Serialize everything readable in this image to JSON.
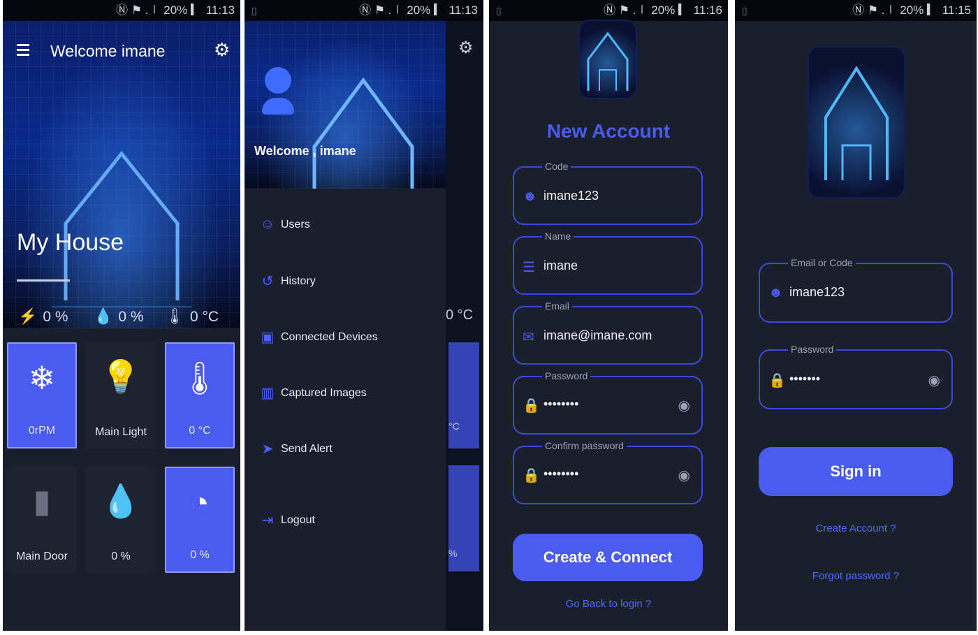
{
  "status": {
    "p1": "Ⓝ ⚑ .∣ 20% ▎ 11:13",
    "p2": "Ⓝ ⚑ .∣ 20% ▎ 11:13",
    "p3": "Ⓝ ⚑ .∣ 20% ▎ 11:16",
    "p4": "Ⓝ ⚑ .∣ 20% ▎ 11:15"
  },
  "home": {
    "welcome": "Welcome imane",
    "house_title": "My House",
    "stats": [
      {
        "icon": "bolt-icon",
        "glyph": "⚡",
        "value": "0 %"
      },
      {
        "icon": "humidity-icon",
        "glyph": "💧",
        "value": "0 %"
      },
      {
        "icon": "thermometer-icon",
        "glyph": "🌡",
        "value": "0 °C"
      }
    ],
    "tiles": [
      {
        "label": "0rPM",
        "icon": "fan-icon",
        "glyph": "❄",
        "on": true
      },
      {
        "label": "Main Light",
        "icon": "bulb-icon",
        "glyph": "💡",
        "on": false
      },
      {
        "label": "0 °C",
        "icon": "thermometer-icon",
        "glyph": "🌡",
        "on": true
      },
      {
        "label": "Main Door",
        "icon": "door-icon",
        "glyph": "▮",
        "on": false
      },
      {
        "label": "0 %",
        "icon": "water-drop-icon",
        "glyph": "💧",
        "on": false
      },
      {
        "label": "0 %",
        "icon": "gauge-icon",
        "glyph": "◔",
        "on": true
      }
    ]
  },
  "drawer": {
    "welcome": "Welcome , imane",
    "behind_temp": "0 °C",
    "behind_c": "°C",
    "behind_pct": "%",
    "items": [
      {
        "label": "Users",
        "icon": "users-icon",
        "glyph": "☺"
      },
      {
        "label": "History",
        "icon": "history-icon",
        "glyph": "↺"
      },
      {
        "label": "Connected Devices",
        "icon": "devices-icon",
        "glyph": "▣"
      },
      {
        "label": "Captured Images",
        "icon": "camera-icon",
        "glyph": "▥"
      },
      {
        "label": "Send Alert",
        "icon": "send-icon",
        "glyph": "➤"
      },
      {
        "label": "Logout",
        "icon": "logout-icon",
        "glyph": "⇥"
      }
    ]
  },
  "signup": {
    "title": "New Account",
    "fields": [
      {
        "label": "Code",
        "value": "imane123",
        "icon": "person-icon",
        "glyph": "☻",
        "secret": false
      },
      {
        "label": "Name",
        "value": "imane",
        "icon": "list-icon",
        "glyph": "☰",
        "secret": false
      },
      {
        "label": "Email",
        "value": "imane@imane.com",
        "icon": "mail-icon",
        "glyph": "✉",
        "secret": false
      },
      {
        "label": "Password",
        "value": "••••••••",
        "icon": "lock-icon",
        "glyph": "🔒",
        "secret": true
      },
      {
        "label": "Confirm password",
        "value": "••••••••",
        "icon": "lock-icon",
        "glyph": "🔒",
        "secret": true
      }
    ],
    "button": "Create & Connect",
    "link": "Go Back to login ?"
  },
  "signin": {
    "fields": [
      {
        "label": "Email or Code",
        "value": "imane123",
        "icon": "person-icon",
        "glyph": "☻",
        "secret": false
      },
      {
        "label": "Password",
        "value": "•••••••",
        "icon": "lock-icon",
        "glyph": "🔒",
        "secret": true
      }
    ],
    "button": "Sign in",
    "create_link": "Create Account ?",
    "forgot_link": "Forgot password ?"
  },
  "colors": {
    "accent": "#4a5cf0",
    "background": "#1b1f2c"
  }
}
